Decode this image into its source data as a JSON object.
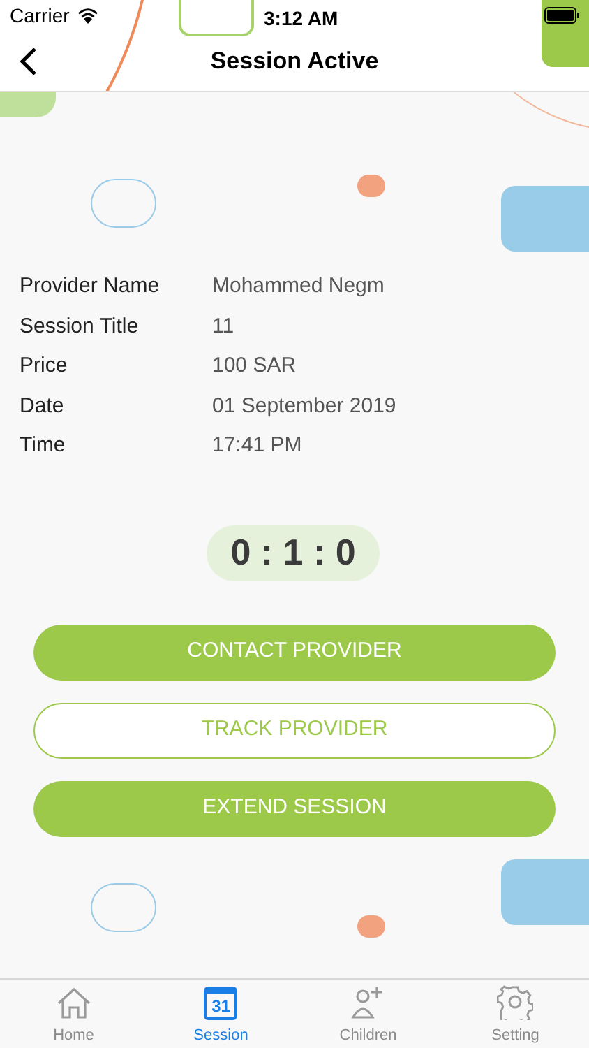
{
  "status_bar": {
    "carrier": "Carrier",
    "time": "3:12 AM"
  },
  "nav": {
    "title": "Session Active"
  },
  "details": [
    {
      "label": "Provider Name",
      "value": "Mohammed Negm"
    },
    {
      "label": "Session Title",
      "value": "11"
    },
    {
      "label": "Price",
      "value": "100 SAR"
    },
    {
      "label": "Date",
      "value": "01 September 2019"
    },
    {
      "label": "Time",
      "value": "17:41 PM"
    }
  ],
  "timer": "0 : 1 : 0",
  "buttons": [
    {
      "label": "CONTACT PROVIDER",
      "kind": "filled"
    },
    {
      "label": "TRACK PROVIDER",
      "kind": "outline"
    },
    {
      "label": "EXTEND SESSION",
      "kind": "filled"
    }
  ],
  "tabs": [
    {
      "label": "Home",
      "kind": "home",
      "selected": false
    },
    {
      "label": "Session",
      "kind": "calendar",
      "selected": true,
      "icon_text": "31"
    },
    {
      "label": "Children",
      "kind": "person-add",
      "selected": false
    },
    {
      "label": "Setting",
      "kind": "gear",
      "selected": false
    }
  ]
}
